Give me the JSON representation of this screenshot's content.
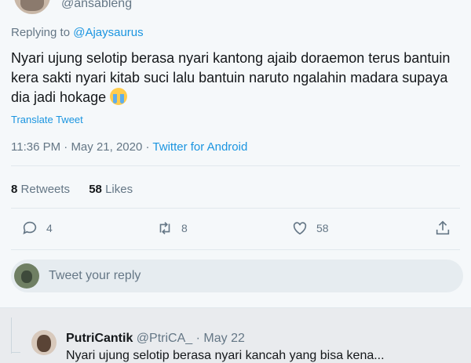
{
  "tweet": {
    "handle": "@ansableng",
    "replying_prefix": "Replying to",
    "replying_to": "@Ajaysaurus",
    "text": "Nyari ujung selotip berasa nyari kantong ajaib doraemon terus bantuin kera sakti nyari kitab suci lalu bantuin naruto ngalahin madara supaya dia jadi hokage",
    "translate_label": "Translate Tweet",
    "time": "11:36 PM",
    "separator": " · ",
    "date": "May 21, 2020",
    "source": "Twitter for Android",
    "retweets_count": "8",
    "retweets_label": "Retweets",
    "likes_count": "58",
    "likes_label": "Likes"
  },
  "actions": {
    "reply_count": "4",
    "retweet_count": "8",
    "like_count": "58"
  },
  "reply_box": {
    "placeholder": "Tweet your reply"
  },
  "reply_tweet": {
    "name": "PutriCantik",
    "handle": "@PtriCA_",
    "separator": " · ",
    "date": "May 22",
    "text_partial": "Nyari ujung selotip berasa nyari kancah yang bisa kena..."
  },
  "colors": {
    "accent": "#1b95e0",
    "muted": "#657786",
    "text": "#14171a",
    "background": "#f5f8fa"
  }
}
